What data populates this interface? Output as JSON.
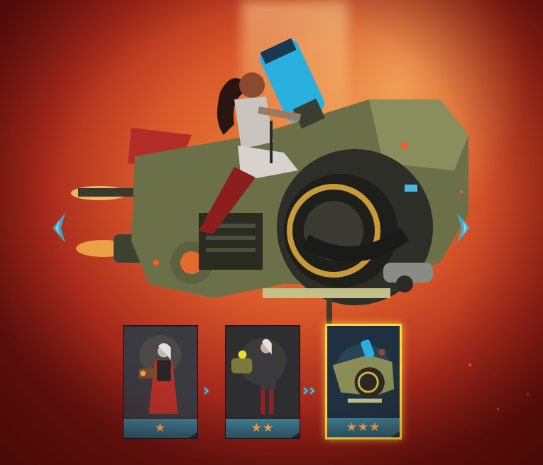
{
  "evolution": {
    "stages": [
      {
        "name": "stage-1",
        "stars": "★"
      },
      {
        "name": "stage-2",
        "stars": "★★"
      },
      {
        "name": "stage-3",
        "stars": "★★★"
      }
    ],
    "selected_stage": 3,
    "step_arrows": [
      "›",
      "››"
    ]
  },
  "navigation": {
    "prev_icon": "chevron-left-icon",
    "next_icon": "chevron-right-icon"
  },
  "colors": {
    "star": "#f2a64c",
    "selected_border": "#ffd93a",
    "arrow": "#36c4e8",
    "card_footer": "#3f7f95"
  }
}
